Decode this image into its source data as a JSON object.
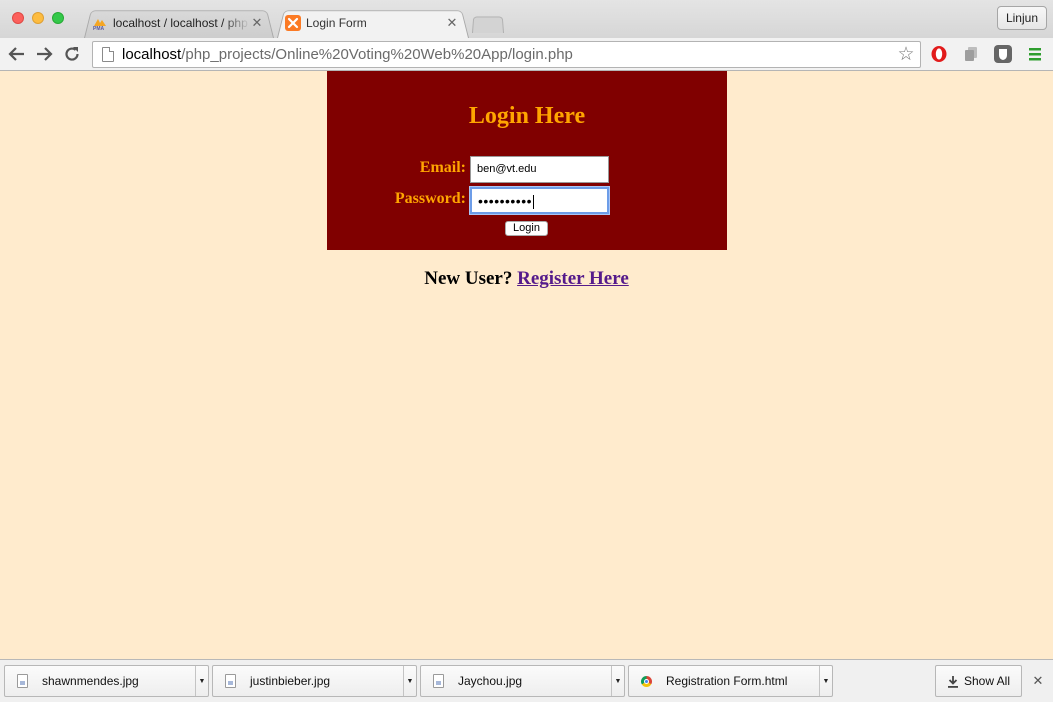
{
  "browser": {
    "tabs": [
      {
        "title": "localhost / localhost / php",
        "favicon": "phpmyadmin-icon",
        "active": false
      },
      {
        "title": "Login Form",
        "favicon": "xampp-icon",
        "active": true
      }
    ],
    "tab_close_glyph": "✕",
    "profile_name": "Linjun",
    "url_host": "localhost",
    "url_path": "/php_projects/Online%20Voting%20Web%20App/login.php"
  },
  "login": {
    "title": "Login Here",
    "email_label": "Email:",
    "email_value": "ben@vt.edu",
    "password_label": "Password:",
    "password_masked": "••••••••••",
    "button_label": "Login",
    "accent_color": "#ffa500",
    "box_color": "#800000"
  },
  "register": {
    "prompt": "New User? ",
    "link_text": "Register Here"
  },
  "downloads": {
    "items": [
      {
        "name": "shawnmendes.jpg",
        "icon": "image-file-icon"
      },
      {
        "name": "justinbieber.jpg",
        "icon": "image-file-icon"
      },
      {
        "name": "Jaychou.jpg",
        "icon": "image-file-icon"
      },
      {
        "name": "Registration Form.html",
        "icon": "chrome-html-icon"
      }
    ],
    "show_all_label": "Show All",
    "close_glyph": "✕"
  },
  "page_background": "#ffebcd"
}
